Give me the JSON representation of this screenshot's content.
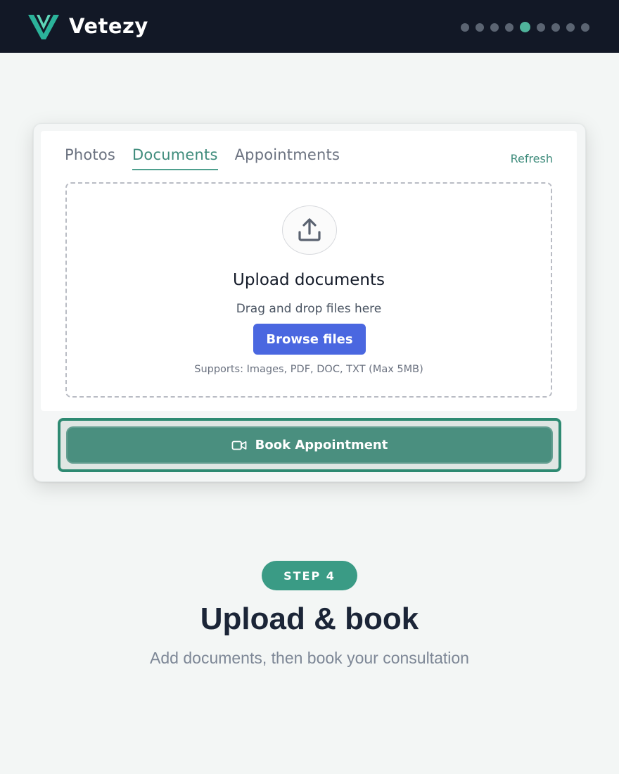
{
  "header": {
    "brand": "Vetezy",
    "logo_icon": "vetezy-v-logo-icon",
    "progress": {
      "total_steps": 9,
      "current_step": 5
    }
  },
  "tabs": [
    {
      "label": "Photos",
      "active": false
    },
    {
      "label": "Documents",
      "active": true
    },
    {
      "label": "Appointments",
      "active": false
    }
  ],
  "refresh_label": "Refresh",
  "upload": {
    "icon": "upload-icon",
    "title": "Upload documents",
    "subtitle": "Drag and drop files here",
    "browse_label": "Browse files",
    "supports": "Supports: Images, PDF, DOC, TXT (Max 5MB)"
  },
  "book": {
    "icon": "video-camera-icon",
    "label": "Book Appointment"
  },
  "step": {
    "badge": "STEP 4",
    "title": "Upload & book",
    "subtitle": "Add documents, then book your consultation"
  },
  "colors": {
    "topbar": "#121826",
    "accent": "#3a9b85",
    "browse": "#4a67e0",
    "book": "#4a8f7f"
  }
}
